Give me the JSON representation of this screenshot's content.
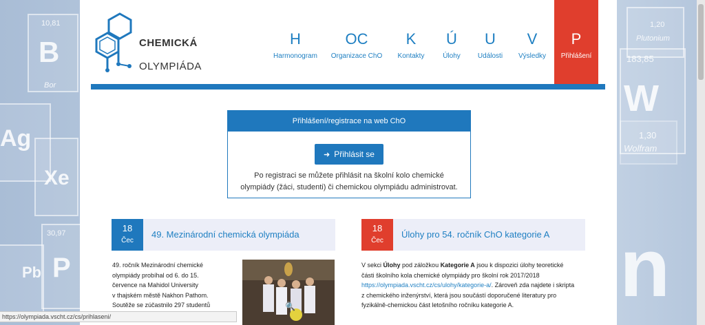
{
  "logo": {
    "line1": "CHEMICKÁ",
    "line2": "OLYMPIÁDA"
  },
  "background_tiles": [
    {
      "number": "10,81",
      "symbol": "B",
      "name": "Bor"
    },
    {
      "number": "",
      "symbol": "Ag",
      "name": ""
    },
    {
      "number": "",
      "symbol": "Xe",
      "name": ""
    },
    {
      "number": "30,97",
      "symbol": "P",
      "name": ""
    },
    {
      "number": "",
      "symbol": "Pb",
      "name": ""
    },
    {
      "number": "1,20",
      "symbol": "",
      "name": "Plutonium"
    },
    {
      "number": "183,85",
      "symbol": "W",
      "name": "Wolfram"
    },
    {
      "number": "1,30",
      "symbol": "",
      "name": ""
    }
  ],
  "nav": [
    {
      "letter": "H",
      "label": "Harmonogram"
    },
    {
      "letter": "OC",
      "label": "Organizace ChO"
    },
    {
      "letter": "K",
      "label": "Kontakty"
    },
    {
      "letter": "Ú",
      "label": "Úlohy"
    },
    {
      "letter": "U",
      "label": "Události"
    },
    {
      "letter": "V",
      "label": "Výsledky"
    },
    {
      "letter": "P",
      "label": "Přihlášení"
    }
  ],
  "login": {
    "header": "Přihlášení/registrace na web ChO",
    "button": "Přihlásit se",
    "text_line1": "Po registraci se můžete přihlásit na školní kolo chemické",
    "text_line2": "olympiády (žáci, studenti) či chemickou olympiádu administrovat."
  },
  "cards": [
    {
      "day": "18",
      "month": "Čec",
      "title": "49. Mezinárodní chemická olympiáda",
      "lines": [
        "49. ročník Mezinárodní chemické",
        "olympiády  probíhal od 6. do 15.",
        "července na Mahidol University",
        "v thajském městě Nakhon Pathom.",
        "Soutěže se zúčastnilo 297 studentů"
      ]
    },
    {
      "day": "18",
      "month": "Čec",
      "title": "Úlohy pro 54. ročník ChO kategorie A",
      "intro": "V sekci ",
      "b1": "Úlohy",
      "mid": " pod záložkou ",
      "b2": "Kategorie A",
      "rest1": " jsou k dispozici úlohy teoretické",
      "line2": "části školního kola chemické olympiády pro školní rok 2017/2018",
      "link": "https://olympiada.vscht.cz/cs/ulohy/kategorie-a/",
      "line3_rest": ". Zároveň zda najdete i skripta",
      "line4": "z chemického inženýrství, která jsou součástí doporučené literatury pro",
      "line5": "fyzikálně-chemickou část letošního ročníku kategorie A."
    }
  ],
  "status_bar": "https://olympiada.vscht.cz/cs/prihlaseni/",
  "colors": {
    "primary": "#1f78bd",
    "accent": "#e03e2d",
    "card_bg": "#eceef8"
  }
}
